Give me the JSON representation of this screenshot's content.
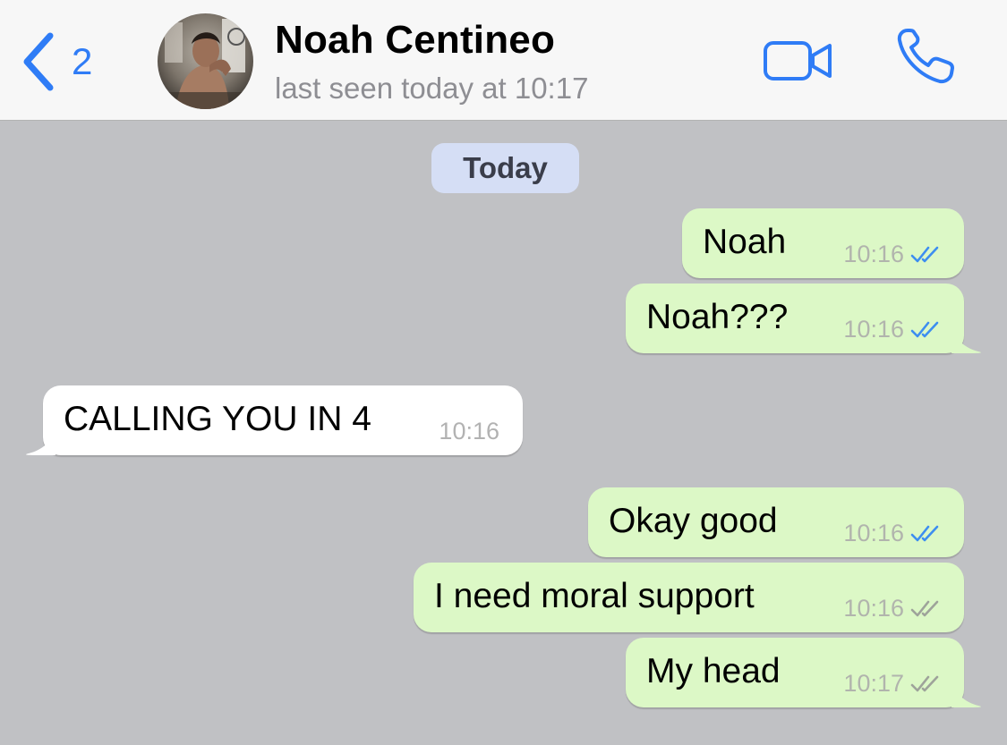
{
  "header": {
    "back_count": "2",
    "contact_name": "Noah Centineo",
    "status": "last seen today at 10:17"
  },
  "date_divider": "Today",
  "messages": [
    {
      "direction": "outgoing",
      "text": "Noah",
      "time": "10:16",
      "status": "read"
    },
    {
      "direction": "outgoing",
      "text": "Noah???",
      "time": "10:16",
      "status": "read"
    },
    {
      "direction": "incoming",
      "text": "CALLING YOU IN 4",
      "time": "10:16"
    },
    {
      "direction": "outgoing",
      "text": "Okay good",
      "time": "10:16",
      "status": "read"
    },
    {
      "direction": "outgoing",
      "text": "I need moral support",
      "time": "10:16",
      "status": "delivered"
    },
    {
      "direction": "outgoing",
      "text": "My head",
      "time": "10:17",
      "status": "delivered"
    }
  ],
  "icons": {
    "back": "chevron-left-icon",
    "video": "video-camera-icon",
    "call": "phone-icon",
    "read_receipt": "double-check-icon"
  },
  "colors": {
    "accent": "#2f7cf6",
    "outgoing_bubble": "#dcf8c6",
    "incoming_bubble": "#ffffff",
    "chat_background": "#c0c1c4",
    "date_pill": "#d5def5",
    "read_ticks": "#3d8ef0",
    "delivered_ticks": "#9ea39a"
  }
}
